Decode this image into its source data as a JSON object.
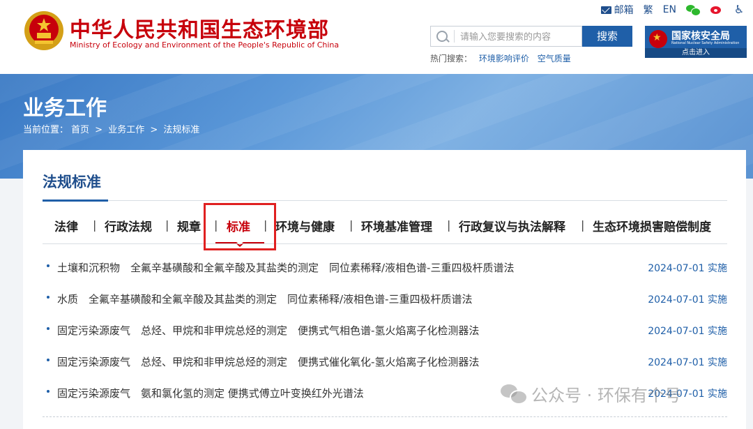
{
  "header": {
    "title_cn": "中华人民共和国生态环境部",
    "title_en": "Ministry of Ecology and Environment of the People's Republic of China",
    "links": {
      "mail": "邮箱",
      "traditional": "繁",
      "english": "EN"
    },
    "search": {
      "placeholder": "请输入您要搜索的内容",
      "button": "搜索",
      "hot_label": "热门搜索：",
      "hot_items": [
        "环境影响评价",
        "空气质量"
      ]
    },
    "nuclear": {
      "title": "国家核安全局",
      "subtitle": "National Nuclear Safety Administration",
      "enter": "点击进入"
    }
  },
  "banner": {
    "title": "业务工作",
    "breadcrumb": {
      "label": "当前位置：",
      "home": "首页",
      "sep": ">",
      "level1": "业务工作",
      "current": "法规标准"
    }
  },
  "section": {
    "title": "法规标准",
    "tabs": [
      "法律",
      "行政法规",
      "规章",
      "标准",
      "环境与健康",
      "环境基准管理",
      "行政复议与执法解释",
      "生态环境损害赔偿制度"
    ],
    "separator": "|",
    "active_tab": "标准"
  },
  "items": [
    {
      "title": "土壤和沉积物　全氟辛基磺酸和全氟辛酸及其盐类的测定　同位素稀释/液相色谱-三重四极杆质谱法",
      "date": "2024-07-01 实施"
    },
    {
      "title": "水质　全氟辛基磺酸和全氟辛酸及其盐类的测定　同位素稀释/液相色谱-三重四极杆质谱法",
      "date": "2024-07-01 实施"
    },
    {
      "title": "固定污染源废气　总烃、甲烷和非甲烷总烃的测定　便携式气相色谱-氢火焰离子化检测器法",
      "date": "2024-07-01 实施"
    },
    {
      "title": "固定污染源废气　总烃、甲烷和非甲烷总烃的测定　便携式催化氧化-氢火焰离子化检测器法",
      "date": "2024-07-01 实施"
    },
    {
      "title": "固定污染源废气　氨和氯化氢的测定 便携式傅立叶变换红外光谱法",
      "date": "2024-07-01 实施"
    }
  ],
  "watermark": "公众号 · 环保有个号",
  "colors": {
    "brand_red": "#c7000b",
    "brand_blue": "#1f5fa8",
    "highlight": "#e02020"
  }
}
